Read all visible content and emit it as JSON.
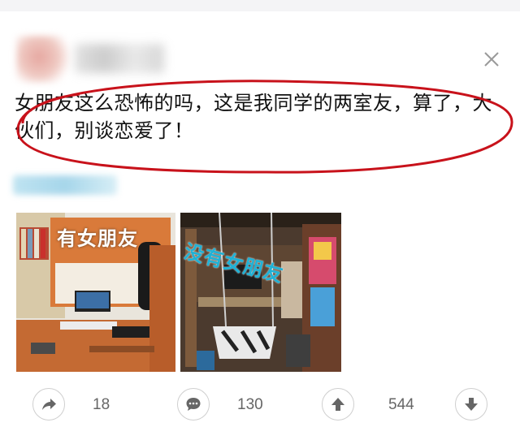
{
  "post": {
    "text": "女朋友这么恐怖的吗，这是我同学的两室友，算了，大伙们，别谈恋爱了！"
  },
  "photos": [
    {
      "label": "有女朋友"
    },
    {
      "label": "没有女朋友"
    }
  ],
  "actions": {
    "share_count": "18",
    "comment_count": "130",
    "upvote_count": "544"
  },
  "icons": {
    "close": "close-icon",
    "share": "share-icon",
    "comment": "comment-icon",
    "upvote": "upvote-icon",
    "downvote": "downvote-icon"
  },
  "colors": {
    "annotation_oval": "#c8121b",
    "label_green_room": "#ffffff",
    "label_messy_room": "#1fb2d6"
  }
}
